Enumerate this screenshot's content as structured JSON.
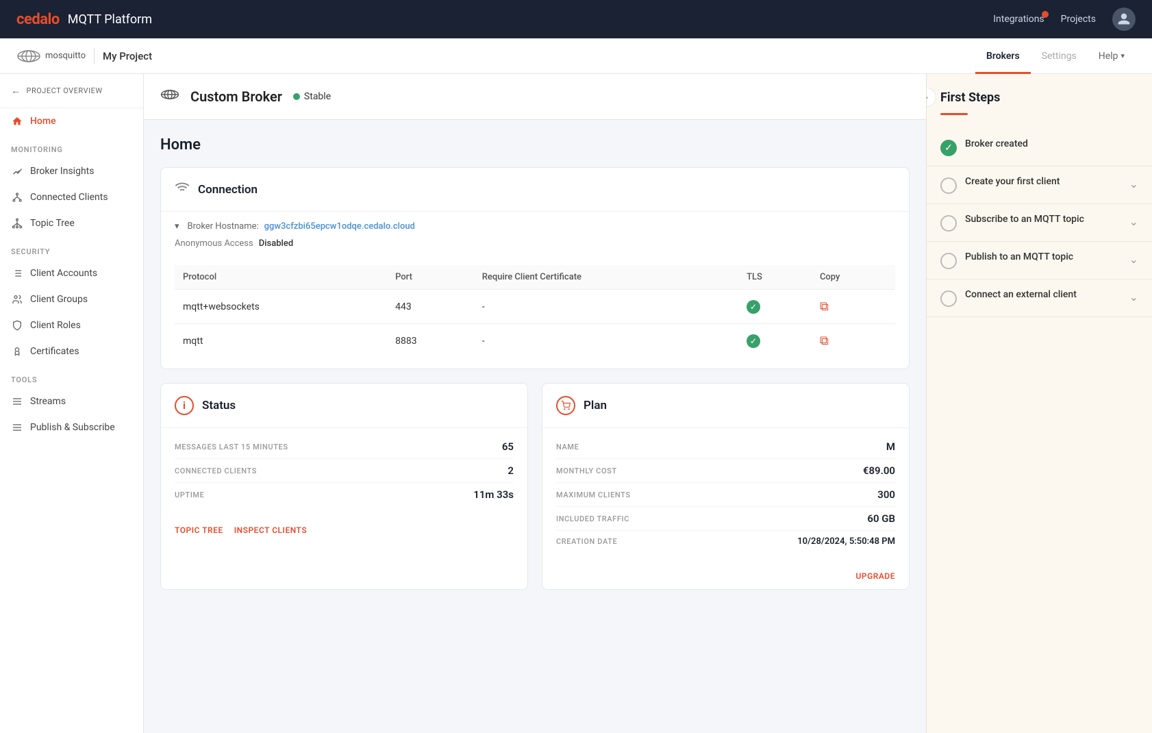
{
  "app": {
    "logo": "cedalo",
    "platform": "MQTT Platform",
    "integrations": "Integrations",
    "projects": "Projects"
  },
  "second_nav": {
    "project": "My Project",
    "tabs": [
      "Brokers",
      "Settings",
      "Help"
    ]
  },
  "sidebar": {
    "project_overview": "PROJECT OVERVIEW",
    "home": "Home",
    "monitoring": "MONITORING",
    "broker_insights": "Broker Insights",
    "connected_clients": "Connected Clients",
    "topic_tree": "Topic Tree",
    "security": "SECURITY",
    "client_accounts": "Client Accounts",
    "client_groups": "Client Groups",
    "client_roles": "Client Roles",
    "certificates": "Certificates",
    "tools": "TOOLS",
    "streams": "Streams",
    "publish_subscribe": "Publish & Subscribe"
  },
  "broker": {
    "name": "Custom Broker",
    "status": "Stable"
  },
  "home": {
    "title": "Home"
  },
  "connection": {
    "section_title": "Connection",
    "hostname_label": "Broker Hostname:",
    "hostname_value": "ggw3cfzbi65epcw1odqe.cedalo.cloud",
    "anonymous_label": "Anonymous Access",
    "anonymous_value": "Disabled",
    "protocols": [
      {
        "protocol": "mqtt+websockets",
        "port": "443",
        "require_cert": "-",
        "tls": true
      },
      {
        "protocol": "mqtt",
        "port": "8883",
        "require_cert": "-",
        "tls": true
      }
    ],
    "col_protocol": "Protocol",
    "col_port": "Port",
    "col_require_cert": "Require Client Certificate",
    "col_tls": "TLS",
    "col_copy": "Copy"
  },
  "status": {
    "section_title": "Status",
    "messages_label": "MESSAGES LAST 15 MINUTES",
    "messages_value": "65",
    "clients_label": "CONNECTED CLIENTS",
    "clients_value": "2",
    "uptime_label": "UPTIME",
    "uptime_value": "11m 33s",
    "link_topic_tree": "TOPIC TREE",
    "link_inspect": "INSPECT CLIENTS"
  },
  "plan": {
    "section_title": "Plan",
    "name_label": "NAME",
    "name_value": "M",
    "cost_label": "MONTHLY COST",
    "cost_value": "€89.00",
    "max_clients_label": "MAXIMUM CLIENTS",
    "max_clients_value": "300",
    "traffic_label": "INCLUDED TRAFFIC",
    "traffic_value": "60 GB",
    "creation_label": "CREATION DATE",
    "creation_value": "10/28/2024, 5:50:48 PM",
    "upgrade_link": "UPGRADE"
  },
  "first_steps": {
    "title": "First Steps",
    "steps": [
      {
        "label": "Broker created",
        "done": true
      },
      {
        "label": "Create your first client",
        "done": false
      },
      {
        "label": "Subscribe to an MQTT topic",
        "done": false
      },
      {
        "label": "Publish to an MQTT topic",
        "done": false
      },
      {
        "label": "Connect an external client",
        "done": false
      }
    ]
  }
}
